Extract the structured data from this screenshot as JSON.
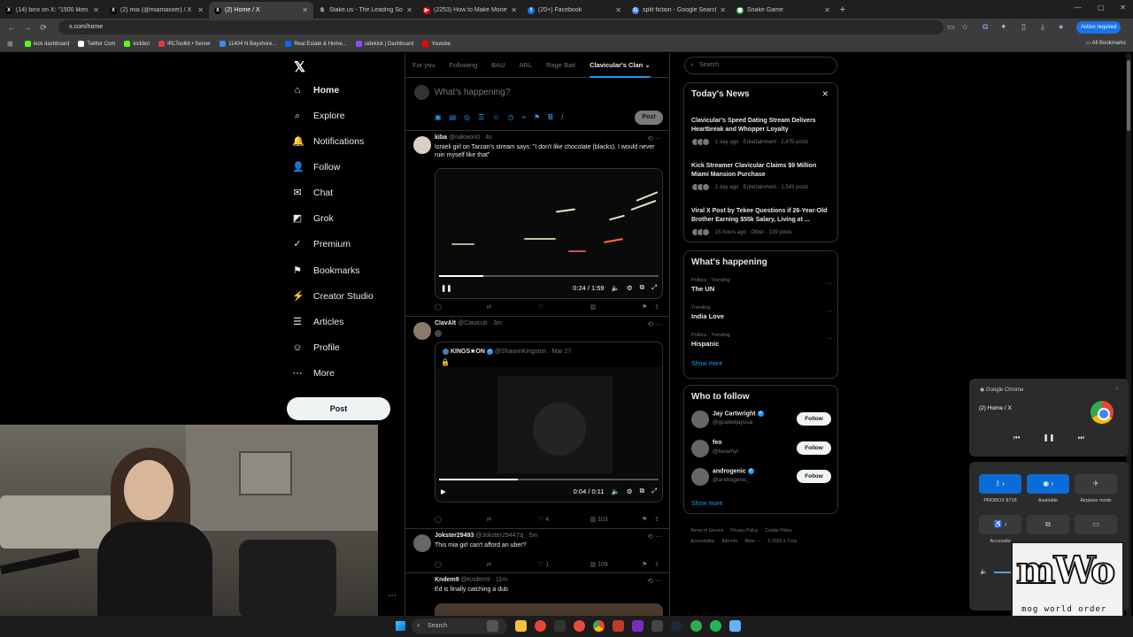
{
  "browser": {
    "tabs": [
      {
        "title": "(14) binx on X: \"1500 likes on a",
        "fav": "X",
        "color": "#000000"
      },
      {
        "title": "(2) mia (@miamaxxer) / X",
        "fav": "X",
        "color": "#000000"
      },
      {
        "title": "(2) Home / X",
        "fav": "X",
        "color": "#000000",
        "active": true
      },
      {
        "title": "Stake.us - The Leading Social C",
        "fav": "S",
        "color": "#1a2c38"
      },
      {
        "title": "(2253) How to Make Money on",
        "fav": "▶",
        "color": "#ff0000"
      },
      {
        "title": "(20+) Facebook",
        "fav": "f",
        "color": "#1877f2"
      },
      {
        "title": "split fiction - Google Search",
        "fav": "G",
        "color": "#4285f4"
      },
      {
        "title": "Snake Game",
        "fav": "▦",
        "color": "#34a853"
      }
    ],
    "url": "x.com/home",
    "action_required": "Action required",
    "bookmarks": [
      {
        "label": "kick dashboard",
        "color": "#53fc18"
      },
      {
        "label": "Twitter Com",
        "color": "#ffffff"
      },
      {
        "label": "kickbot",
        "color": "#53fc18"
      },
      {
        "label": "IRLToolkit • Server",
        "color": "#e03c3c"
      },
      {
        "label": "11404 N Bayshore...",
        "color": "#4285f4"
      },
      {
        "label": "Real Estate & Home...",
        "color": "#006aff"
      },
      {
        "label": "sidekick | Dashboard",
        "color": "#8a4dff"
      },
      {
        "label": "Youtube",
        "color": "#ff0000"
      }
    ],
    "all_bookmarks": "All Bookmarks"
  },
  "nav": {
    "logo": "𝕏",
    "items": [
      {
        "label": "Home",
        "icon": "⌂",
        "icon_name": "home-icon"
      },
      {
        "label": "Explore",
        "icon": "⌕",
        "icon_name": "search-icon"
      },
      {
        "label": "Notifications",
        "icon": "🔔",
        "icon_name": "bell-icon"
      },
      {
        "label": "Follow",
        "icon": "👤",
        "icon_name": "person-add-icon"
      },
      {
        "label": "Chat",
        "icon": "✉",
        "icon_name": "mail-icon"
      },
      {
        "label": "Grok",
        "icon": "◩",
        "icon_name": "grok-icon"
      },
      {
        "label": "Premium",
        "icon": "✓",
        "icon_name": "premium-icon"
      },
      {
        "label": "Bookmarks",
        "icon": "⚑",
        "icon_name": "bookmark-icon"
      },
      {
        "label": "Creator Studio",
        "icon": "⚡",
        "icon_name": "creator-studio-icon"
      },
      {
        "label": "Articles",
        "icon": "☰",
        "icon_name": "articles-icon"
      },
      {
        "label": "Profile",
        "icon": "☺",
        "icon_name": "profile-icon"
      },
      {
        "label": "More",
        "icon": "⋯",
        "icon_name": "more-icon"
      }
    ],
    "post": "Post"
  },
  "timeline": {
    "tabs": [
      "For you",
      "Following",
      "BAU",
      "ARL",
      "Rage Bait",
      "Clavicular's Clan"
    ],
    "composer": {
      "placeholder": "What's happening?",
      "post": "Post"
    },
    "tweets": [
      {
        "name": "kiba",
        "handle": "@nakwon0",
        "time": "4s",
        "text": "Israeli girl on Tarzan's stream says: \"I don't like chocolate (blacks). I would never ruin myself like that\"",
        "video_time": "0:24 / 1:59",
        "progress": 0.2
      },
      {
        "name": "ClavAlt",
        "handle": "@Claviculr",
        "time": "3m",
        "quote": {
          "name": "KINGS★ON",
          "handle": "@ShaunnKingston",
          "time": "Mar 27"
        },
        "video_time": "0:04 / 0:11",
        "progress": 0.36,
        "likes": "4",
        "views": "103"
      },
      {
        "name": "Jokster29493",
        "handle": "@Jokster29447sj",
        "time": "5m",
        "text": "This mia girl can't afford an uber?",
        "likes": "1",
        "views": "109"
      },
      {
        "name": "Kndem9",
        "handle": "@Kndem9",
        "time": "11m",
        "text": "Ed is finally catching a dub"
      }
    ]
  },
  "right": {
    "search_placeholder": "Search",
    "news": {
      "title": "Today's News",
      "items": [
        {
          "headline": "Clavicular's Speed Dating Stream Delivers Heartbreak and Whopper Loyalty",
          "meta": "1 day ago · Entertainment · 2,475 posts"
        },
        {
          "headline": "Kick Streamer Clavicular Claims $9 Million Miami Mansion Purchase",
          "meta": "1 day ago · Entertainment · 1,543 posts"
        },
        {
          "headline": "Viral X Post by Tekee Questions if 26-Year-Old Brother Earning $55k Salary, Living at ...",
          "meta": "15 hours ago · Other · 139 posts"
        }
      ]
    },
    "happening": {
      "title": "What's happening",
      "trends": [
        {
          "context": "Politics · Trending",
          "topic": "The UN"
        },
        {
          "context": "Trending",
          "topic": "India Love"
        },
        {
          "context": "Politics · Trending",
          "topic": "Hispanic"
        }
      ],
      "show_more": "Show more"
    },
    "who_to_follow": {
      "title": "Who to follow",
      "people": [
        {
          "name": "Jay Cartwright",
          "handle": "@goatedjayusa",
          "verified": true
        },
        {
          "name": "feo",
          "handle": "@feowhyt",
          "verified": false
        },
        {
          "name": "androgenic",
          "handle": "@androgenic_",
          "verified": true
        }
      ],
      "follow": "Follow",
      "show_more": "Show more"
    },
    "footer": [
      "Terms of Service",
      "Privacy Policy",
      "Cookie Policy",
      "Accessibility",
      "Ads info",
      "More ···",
      "© 2026 X Corp."
    ]
  },
  "media_flyout": {
    "app": "Google Chrome",
    "title": "(2) Home / X"
  },
  "quick_settings": {
    "tiles": [
      "PROBOX 8716",
      "Available",
      "Airplane mode"
    ],
    "access": "Accessibi"
  },
  "overlay": {
    "logo_text": "mWo",
    "caption": "mog world order"
  },
  "taskbar": {
    "search": "Search"
  }
}
